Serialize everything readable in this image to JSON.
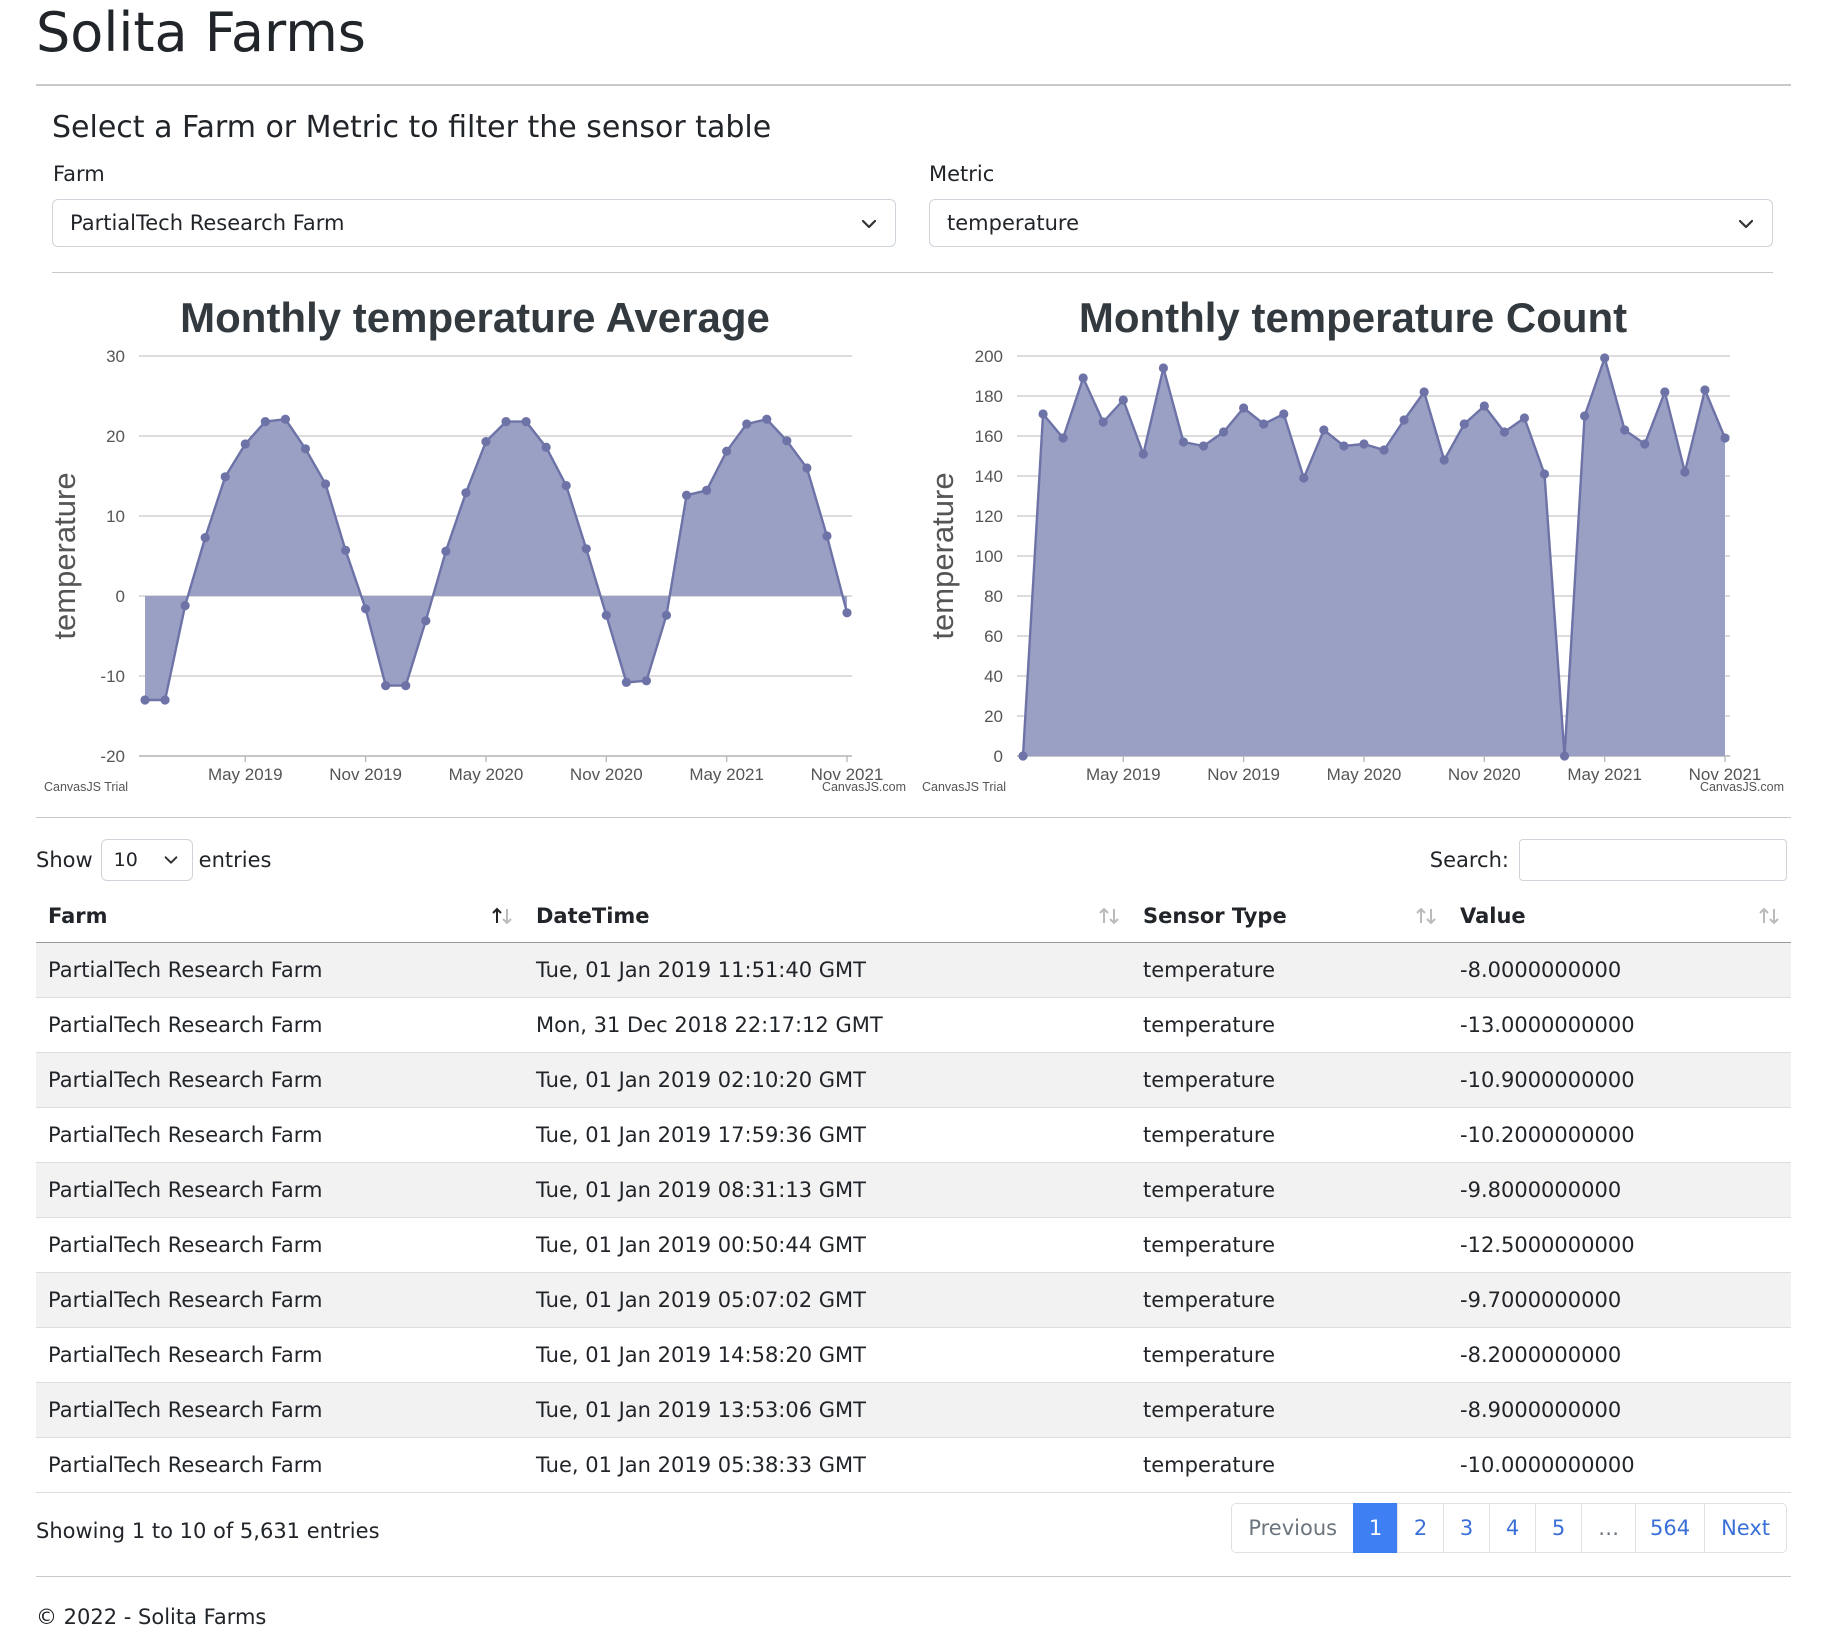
{
  "app": {
    "title": "Solita Farms"
  },
  "filters": {
    "heading": "Select a Farm or Metric to filter the sensor table",
    "farm_label": "Farm",
    "farm_value": "PartialTech Research Farm",
    "metric_label": "Metric",
    "metric_value": "temperature"
  },
  "charts": {
    "credit_left": "CanvasJS Trial",
    "credit_right": "CanvasJS.com"
  },
  "chart_data": [
    {
      "type": "area",
      "title": "Monthly temperature Average",
      "xlabel": "",
      "ylabel": "temperature",
      "ylim": [
        -20,
        30
      ],
      "yticks": [
        -20,
        -10,
        0,
        10,
        20,
        30
      ],
      "xtick_labels": [
        "May 2019",
        "Nov 2019",
        "May 2020",
        "Nov 2020",
        "May 2021",
        "Nov 2021"
      ],
      "grid": true,
      "x": [
        "2018-12",
        "2019-01",
        "2019-02",
        "2019-03",
        "2019-04",
        "2019-05",
        "2019-06",
        "2019-07",
        "2019-08",
        "2019-09",
        "2019-10",
        "2019-11",
        "2019-12",
        "2020-01",
        "2020-02",
        "2020-03",
        "2020-04",
        "2020-05",
        "2020-06",
        "2020-07",
        "2020-08",
        "2020-09",
        "2020-10",
        "2020-11",
        "2020-12",
        "2021-01",
        "2021-02",
        "2021-03",
        "2021-04",
        "2021-05",
        "2021-06",
        "2021-07",
        "2021-08",
        "2021-09",
        "2021-10",
        "2021-11"
      ],
      "values": [
        -13,
        -13,
        -1.2,
        7.3,
        14.9,
        19,
        21.8,
        22.1,
        18.4,
        14,
        5.7,
        -1.6,
        -11.2,
        -11.2,
        -3.1,
        5.6,
        12.9,
        19.3,
        21.8,
        21.8,
        18.6,
        13.8,
        5.9,
        -2.4,
        -10.8,
        -10.6,
        -2.4,
        12.6,
        13.2,
        18.1,
        21.5,
        22.1,
        19.4,
        16,
        7.5,
        -2.1
      ]
    },
    {
      "type": "area",
      "title": "Monthly temperature Count",
      "xlabel": "",
      "ylabel": "temperature",
      "ylim": [
        0,
        200
      ],
      "yticks": [
        0,
        20,
        40,
        60,
        80,
        100,
        120,
        140,
        160,
        180,
        200
      ],
      "xtick_labels": [
        "May 2019",
        "Nov 2019",
        "May 2020",
        "Nov 2020",
        "May 2021",
        "Nov 2021"
      ],
      "grid": true,
      "x": [
        "2018-12",
        "2019-01",
        "2019-02",
        "2019-03",
        "2019-04",
        "2019-05",
        "2019-06",
        "2019-07",
        "2019-08",
        "2019-09",
        "2019-10",
        "2019-11",
        "2019-12",
        "2020-01",
        "2020-02",
        "2020-03",
        "2020-04",
        "2020-05",
        "2020-06",
        "2020-07",
        "2020-08",
        "2020-09",
        "2020-10",
        "2020-11",
        "2020-12",
        "2021-01",
        "2021-02",
        "2021-03",
        "2021-04",
        "2021-05",
        "2021-06",
        "2021-07",
        "2021-08",
        "2021-09",
        "2021-10",
        "2021-11"
      ],
      "values": [
        0,
        171,
        159,
        189,
        167,
        178,
        151,
        194,
        157,
        155,
        162,
        174,
        166,
        171,
        139,
        163,
        155,
        156,
        153,
        168,
        182,
        148,
        166,
        175,
        162,
        169,
        141,
        0,
        170,
        199,
        163,
        156,
        182,
        142,
        183,
        159
      ]
    }
  ],
  "table": {
    "length_prefix": "Show",
    "length_value": "10",
    "length_suffix": "entries",
    "search_label": "Search:",
    "columns": [
      "Farm",
      "DateTime",
      "Sensor Type",
      "Value"
    ],
    "rows": [
      [
        "PartialTech Research Farm",
        "Tue, 01 Jan 2019 11:51:40 GMT",
        "temperature",
        "-8.0000000000"
      ],
      [
        "PartialTech Research Farm",
        "Mon, 31 Dec 2018 22:17:12 GMT",
        "temperature",
        "-13.0000000000"
      ],
      [
        "PartialTech Research Farm",
        "Tue, 01 Jan 2019 02:10:20 GMT",
        "temperature",
        "-10.9000000000"
      ],
      [
        "PartialTech Research Farm",
        "Tue, 01 Jan 2019 17:59:36 GMT",
        "temperature",
        "-10.2000000000"
      ],
      [
        "PartialTech Research Farm",
        "Tue, 01 Jan 2019 08:31:13 GMT",
        "temperature",
        "-9.8000000000"
      ],
      [
        "PartialTech Research Farm",
        "Tue, 01 Jan 2019 00:50:44 GMT",
        "temperature",
        "-12.5000000000"
      ],
      [
        "PartialTech Research Farm",
        "Tue, 01 Jan 2019 05:07:02 GMT",
        "temperature",
        "-9.7000000000"
      ],
      [
        "PartialTech Research Farm",
        "Tue, 01 Jan 2019 14:58:20 GMT",
        "temperature",
        "-8.2000000000"
      ],
      [
        "PartialTech Research Farm",
        "Tue, 01 Jan 2019 13:53:06 GMT",
        "temperature",
        "-8.9000000000"
      ],
      [
        "PartialTech Research Farm",
        "Tue, 01 Jan 2019 05:38:33 GMT",
        "temperature",
        "-10.0000000000"
      ]
    ],
    "info": "Showing 1 to 10 of 5,631 entries",
    "pagination": {
      "previous": "Previous",
      "pages": [
        "1",
        "2",
        "3",
        "4",
        "5"
      ],
      "ellipsis": "…",
      "last_page": "564",
      "next": "Next",
      "current": "1"
    }
  },
  "footer": {
    "text": "© 2022 - Solita Farms"
  },
  "colors": {
    "area_fill": "#9aa0c4",
    "area_line": "#6d73a6",
    "pager_active": "#3f7ff4",
    "pager_link": "#3a6fd8",
    "stripe": "#f2f2f2"
  },
  "icons": {
    "select": "chevron-down-icon",
    "sort_active": "sort-ascending-icon",
    "sort_inactive": "sort-both-icon"
  }
}
